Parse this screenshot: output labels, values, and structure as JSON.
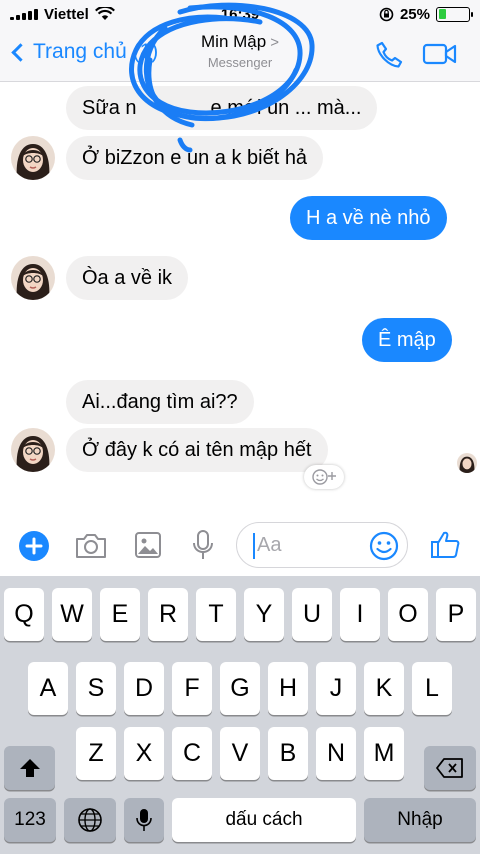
{
  "status_bar": {
    "carrier": "Viettel",
    "time": "16:39",
    "battery": "25%",
    "battery_level": 0.25
  },
  "header": {
    "back_label": "Trang chủ (1)",
    "contact_name": "Min Mập",
    "subtitle": "Messenger",
    "icons": [
      "chevron-left-icon",
      "phone-icon",
      "video-camera-icon"
    ],
    "accent_color": "#1a88ff"
  },
  "messages": [
    {
      "side": "in",
      "text": "Sữa nhiều e mới ún được mà...",
      "visible_text": "Sữa n",
      "visible_tail": "e mới ún ... mà..."
    },
    {
      "side": "in",
      "text": "Ở biZzon e un a k biết hả"
    },
    {
      "side": "out",
      "text": "H a về nè nhỏ"
    },
    {
      "side": "in",
      "text": "Òa a về ik"
    },
    {
      "side": "out",
      "text": "Ê mập"
    },
    {
      "side": "in",
      "text": "Ai...đang tìm ai??"
    },
    {
      "side": "in",
      "text": "Ở đây k có ai tên mập hết"
    }
  ],
  "input": {
    "placeholder": "Aa",
    "icons": [
      "plus-icon",
      "camera-icon",
      "image-icon",
      "microphone-icon",
      "emoji-icon",
      "thumbs-up-icon"
    ]
  },
  "keyboard": {
    "row1": [
      "Q",
      "W",
      "E",
      "R",
      "T",
      "Y",
      "U",
      "I",
      "O",
      "P"
    ],
    "row2": [
      "A",
      "S",
      "D",
      "F",
      "G",
      "H",
      "J",
      "K",
      "L"
    ],
    "row3": [
      "Z",
      "X",
      "C",
      "V",
      "B",
      "N",
      "M"
    ],
    "numbers_key": "123",
    "space_key": "dấu cách",
    "return_key": "Nhập"
  }
}
